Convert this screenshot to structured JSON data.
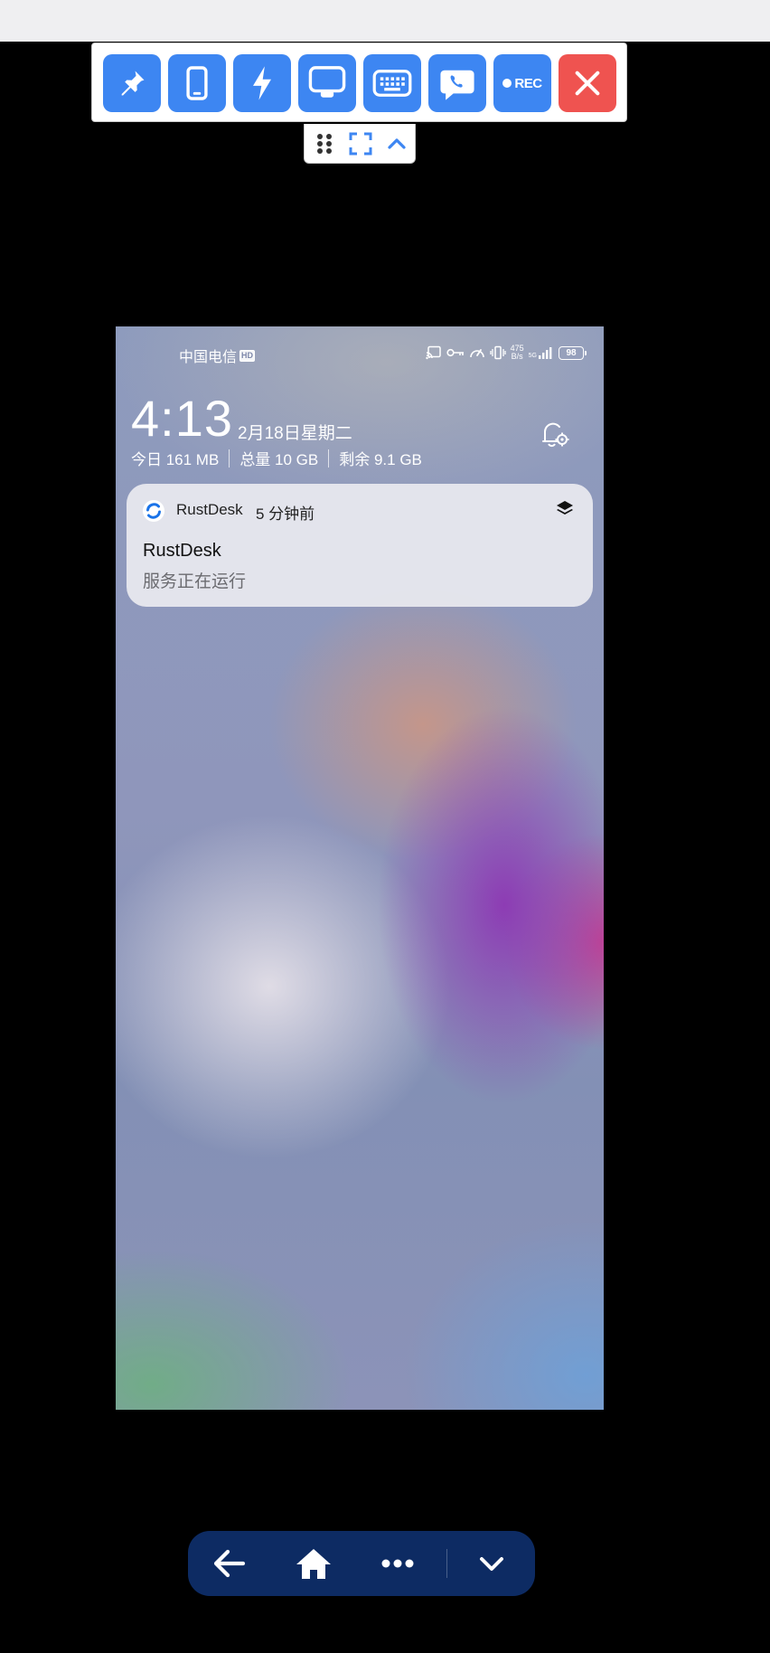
{
  "toolbar": {
    "buttons": [
      {
        "id": "pin",
        "icon": "pin-icon"
      },
      {
        "id": "mobile-actions",
        "icon": "mobile-phone-icon"
      },
      {
        "id": "actions",
        "icon": "lightning-icon"
      },
      {
        "id": "display",
        "icon": "monitor-icon"
      },
      {
        "id": "keyboard",
        "icon": "keyboard-icon"
      },
      {
        "id": "chat",
        "icon": "chat-phone-icon"
      },
      {
        "id": "record",
        "icon": "record-icon",
        "label": "REC"
      },
      {
        "id": "close",
        "icon": "close-icon"
      }
    ],
    "accent_color": "#3d86f2",
    "close_color": "#ef5350"
  },
  "subbar": {
    "icons": [
      "drag-handle-icon",
      "fullscreen-icon",
      "chevron-up-icon"
    ]
  },
  "phone": {
    "status": {
      "carrier": "中国电信",
      "hd": "HD",
      "network_speed_top": "475",
      "network_speed_bottom": "B/s",
      "network_type": "5G",
      "battery": "98"
    },
    "lockscreen": {
      "time": "4:13",
      "date": "2月18日星期二",
      "storage_today": "今日 161 MB",
      "storage_total": "总量 10 GB",
      "storage_remaining": "剩余 9.1 GB"
    },
    "notification": {
      "app": "RustDesk",
      "time_ago": "5 分钟前",
      "title": "RustDesk",
      "body": "服务正在运行"
    }
  },
  "navbar": {
    "buttons": [
      "back-arrow-icon",
      "home-icon",
      "more-icon",
      "chevron-down-icon"
    ],
    "color": "#0d2b63"
  }
}
